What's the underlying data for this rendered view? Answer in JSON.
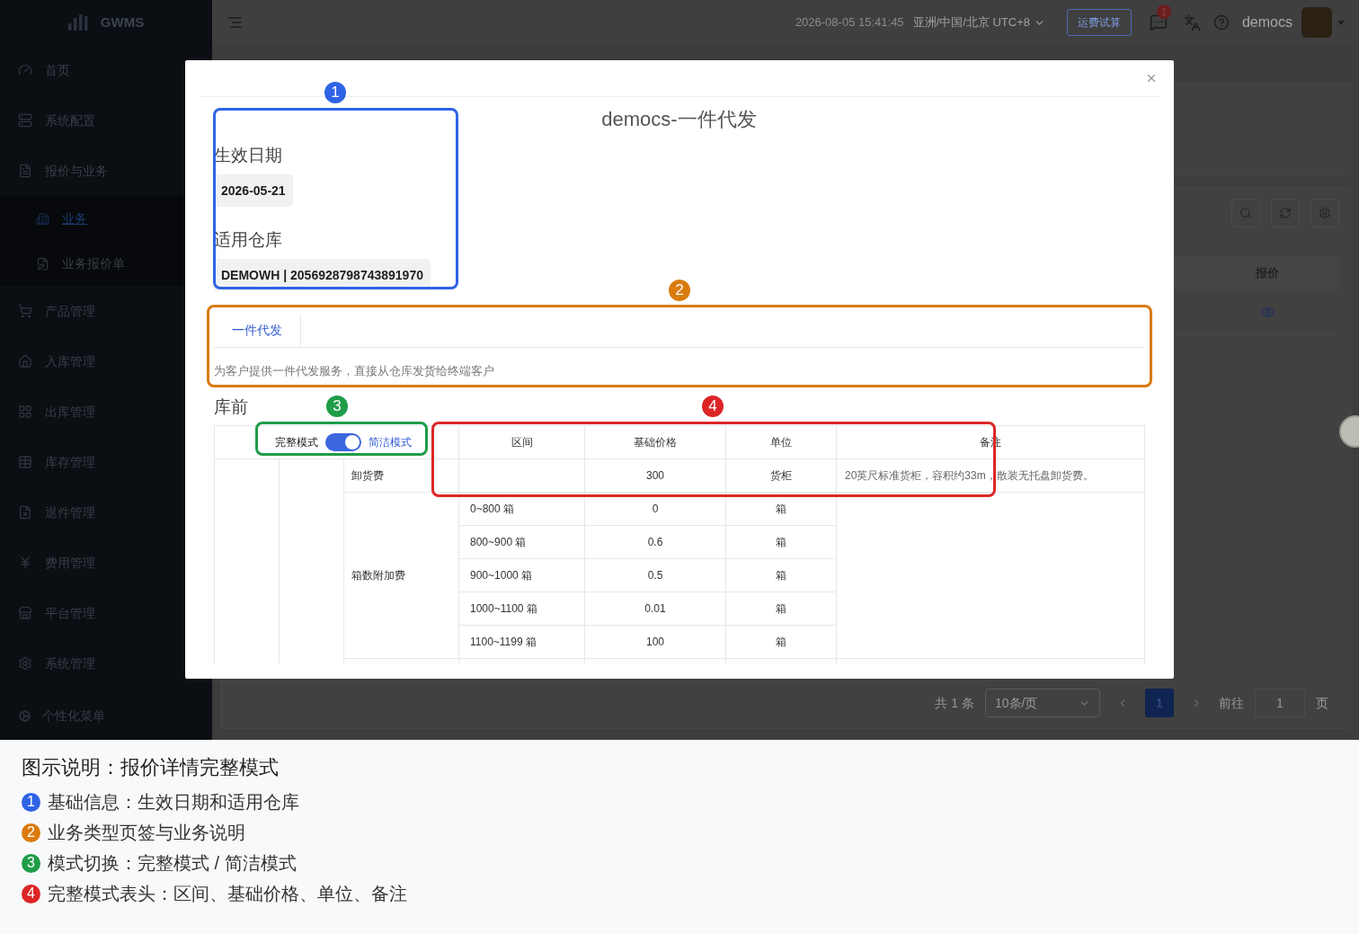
{
  "sidebar": {
    "logo": "GWMS",
    "items": [
      {
        "label": "首页",
        "selected": false
      },
      {
        "label": "系统配置",
        "selected": false
      },
      {
        "label": "报价与业务",
        "selected": false,
        "children": [
          {
            "label": "业务",
            "selected": true
          },
          {
            "label": "业务报价单",
            "selected": false
          }
        ]
      },
      {
        "label": "产品管理",
        "selected": false
      },
      {
        "label": "入库管理",
        "selected": false
      },
      {
        "label": "出库管理",
        "selected": false
      },
      {
        "label": "库存管理",
        "selected": false
      },
      {
        "label": "退件管理",
        "selected": false
      },
      {
        "label": "费用管理",
        "selected": false
      },
      {
        "label": "平台管理",
        "selected": false
      },
      {
        "label": "系统管理",
        "selected": false
      }
    ],
    "footer": "个性化菜单"
  },
  "header": {
    "time": "2026-08-05 15:41:45",
    "timezone": "亚洲/中国/北京 UTC+8",
    "freight_button": "运费试算",
    "message_badge": "1",
    "username": "democs"
  },
  "background": {
    "table_column": "报价",
    "pagination": {
      "total": "共 1 条",
      "page_size": "10条/页",
      "pages": [
        {
          "label": "1",
          "selected": true
        }
      ],
      "goto_label": "前往",
      "goto_value": "1",
      "page_suffix": "页"
    }
  },
  "modal": {
    "title": "democs-一件代发",
    "fields": [
      {
        "label": "生效日期",
        "value": "2026-05-21"
      },
      {
        "label": "适用仓库",
        "value": "DEMOWH | 2056928798743891970"
      }
    ],
    "tabs": [
      {
        "label": "一件代发",
        "selected": true
      }
    ],
    "description": "为客户提供一件代发服务，直接从仓库发货给终端客户",
    "section": "库前",
    "mode_switch": {
      "left_label": "完整模式",
      "right_label": "简洁模式",
      "on": true
    },
    "columns": [
      "区间",
      "基础价格",
      "单位",
      "备注"
    ],
    "fees": [
      {
        "name": "卸货费",
        "note": "20英尺标准货柜，容积约33m，散装无托盘卸货费。",
        "tiers": [
          {
            "price": "300",
            "unit": "货柜"
          }
        ]
      },
      {
        "name": "箱数附加费",
        "tiers": [
          {
            "range": "0~800 箱",
            "price": "0",
            "unit": "箱"
          },
          {
            "range": "800~900 箱",
            "price": "0.6",
            "unit": "箱"
          },
          {
            "range": "900~1000 箱",
            "price": "0.5",
            "unit": "箱"
          },
          {
            "range": "1000~1100 箱",
            "price": "0.01",
            "unit": "箱"
          },
          {
            "range": "1100~1199 箱",
            "price": "100",
            "unit": "箱"
          }
        ]
      }
    ]
  },
  "annotations": [
    {
      "number": "1",
      "color": "#2f63e6"
    },
    {
      "number": "2",
      "color": "#d97b0f"
    },
    {
      "number": "3",
      "color": "#1f9d48"
    },
    {
      "number": "4",
      "color": "#dc2626"
    }
  ],
  "legend": {
    "title": "图示说明：报价详情完整模式",
    "items": [
      {
        "number": "1",
        "text": "基础信息：生效日期和适用仓库",
        "color": "#2f63e6"
      },
      {
        "number": "2",
        "text": "业务类型页签与业务说明",
        "color": "#d97b0f"
      },
      {
        "number": "3",
        "text": "模式切换：完整模式 / 简洁模式",
        "color": "#1f9d48"
      },
      {
        "number": "4",
        "text": "完整模式表头：区间、基础价格、单位、备注",
        "color": "#dc2626"
      }
    ]
  }
}
